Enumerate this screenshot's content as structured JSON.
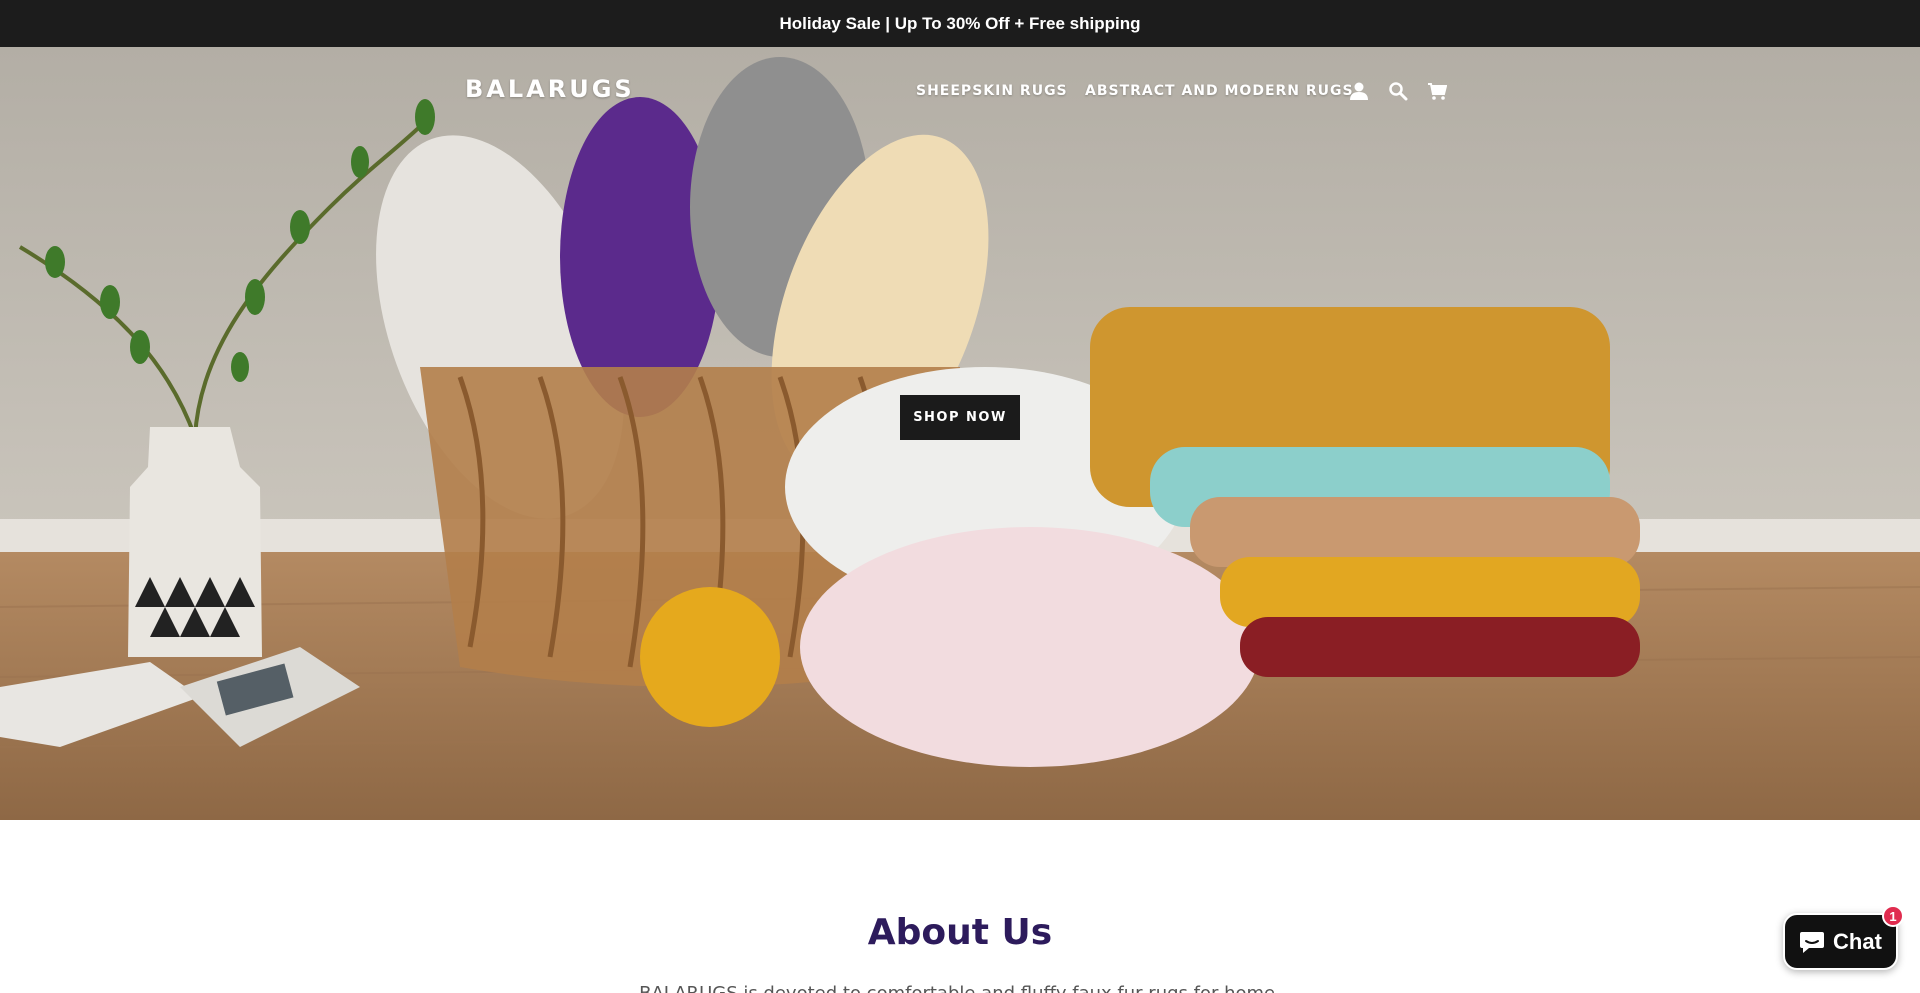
{
  "announcement": {
    "text": "Holiday Sale | Up To 30% Off + Free shipping"
  },
  "header": {
    "logo": "BALARUGS",
    "nav": [
      {
        "label": "SHEEPSKIN RUGS"
      },
      {
        "label": "ABSTRACT AND MODERN RUGS"
      }
    ],
    "icons": [
      "account-icon",
      "search-icon",
      "cart-icon"
    ]
  },
  "hero": {
    "button_label": "SHOP NOW"
  },
  "about": {
    "title": "About Us",
    "text": "BALARUGS is devoted to comfortable and fluffy faux fur rugs for home."
  },
  "chat": {
    "label": "Chat",
    "badge": "1"
  },
  "colors": {
    "announcement_bg": "#1c1c1c",
    "button_bg": "#1b1b1b",
    "about_title": "#2d1b5c",
    "chat_bg": "#111111",
    "badge": "#e02c4f"
  }
}
